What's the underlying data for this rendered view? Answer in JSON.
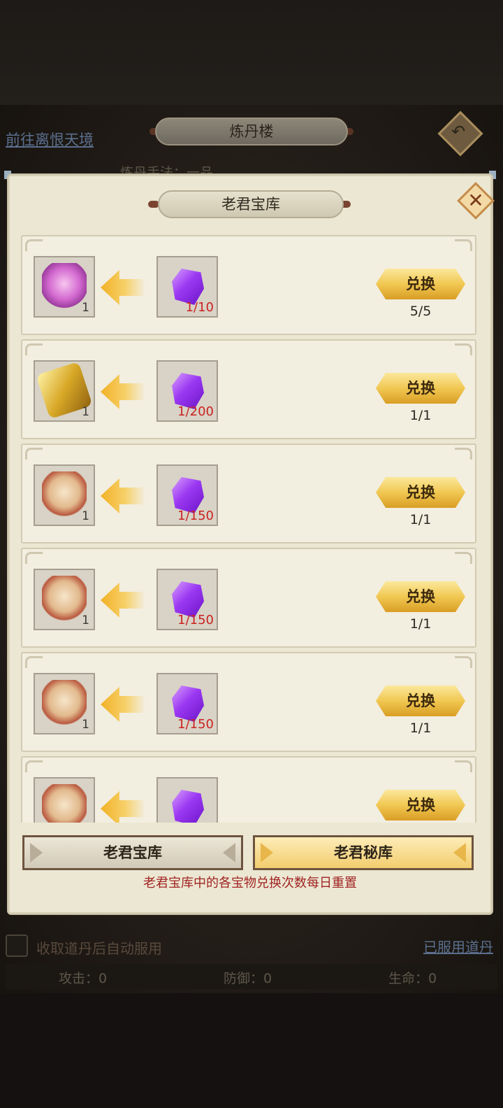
{
  "background": {
    "link_left": "前往离恨天境",
    "title": "炼丹楼",
    "subtitle": "炼丹手法：一品",
    "auto_use_label": "收取道丹后自动服用",
    "link_right": "已服用道丹",
    "stats": [
      "攻击：0",
      "防御：0",
      "生命：0"
    ]
  },
  "modal": {
    "title": "老君宝库",
    "close_icon": "close-icon",
    "items": [
      {
        "reward_art": "pink-treasure",
        "reward_count": "1",
        "cost_count": "1/10",
        "button": "兑换",
        "limit": "5/5"
      },
      {
        "reward_art": "gold-token",
        "reward_count": "1",
        "cost_count": "1/200",
        "button": "兑换",
        "limit": "1/1"
      },
      {
        "reward_art": "scroll",
        "reward_count": "1",
        "cost_count": "1/150",
        "button": "兑换",
        "limit": "1/1"
      },
      {
        "reward_art": "scroll",
        "reward_count": "1",
        "cost_count": "1/150",
        "button": "兑换",
        "limit": "1/1"
      },
      {
        "reward_art": "scroll",
        "reward_count": "1",
        "cost_count": "1/150",
        "button": "兑换",
        "limit": "1/1"
      },
      {
        "reward_art": "scroll",
        "reward_count": "",
        "cost_count": "",
        "button": "兑换",
        "limit": ""
      }
    ],
    "tabs": [
      {
        "label": "老君宝库",
        "active": false
      },
      {
        "label": "老君秘库",
        "active": true
      }
    ],
    "note": "老君宝库中的各宝物兑换次数每日重置"
  },
  "colors": {
    "panel": "#ece7d2",
    "cost_count": "#cc2222",
    "button_gold": "#f1c852",
    "note": "#a02424"
  }
}
